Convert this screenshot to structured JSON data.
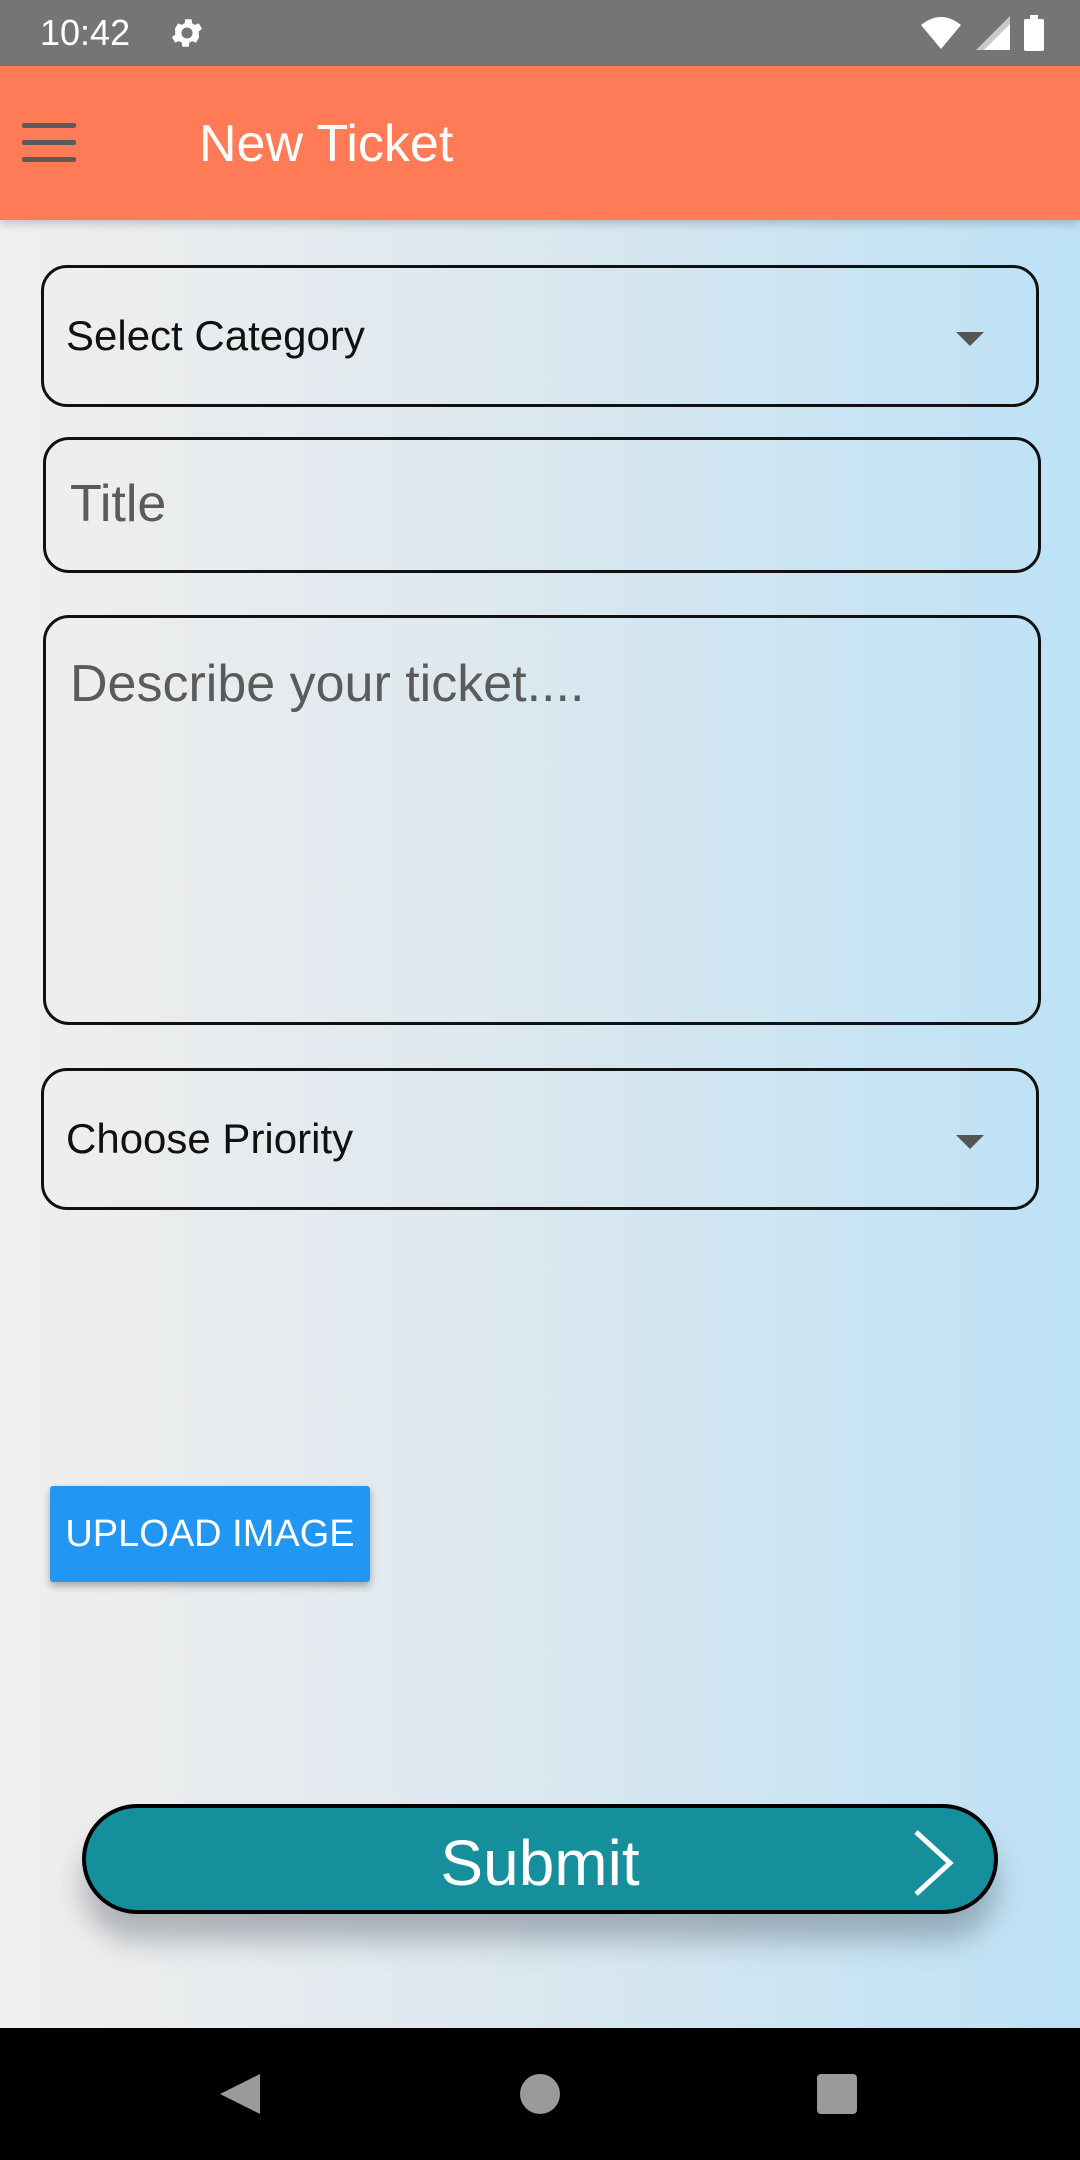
{
  "status_bar": {
    "time": "10:42",
    "icons": [
      "gear-icon",
      "wifi-icon",
      "signal-icon",
      "battery-icon"
    ]
  },
  "app_bar": {
    "title": "New Ticket",
    "menu_icon": "menu-icon",
    "color": "#ff7b57"
  },
  "form": {
    "category_select": {
      "selected": "Select Category"
    },
    "title_input": {
      "placeholder": "Title",
      "value": ""
    },
    "description_input": {
      "placeholder": "Describe your ticket....",
      "value": ""
    },
    "priority_select": {
      "selected": "Choose Priority"
    },
    "upload_button": {
      "label": "UPLOAD IMAGE",
      "color": "#2196f3"
    },
    "submit_button": {
      "label": "Submit",
      "color": "#168f9d"
    }
  },
  "nav_bar": {
    "buttons": [
      "back-icon",
      "home-icon",
      "recent-apps-icon"
    ]
  }
}
